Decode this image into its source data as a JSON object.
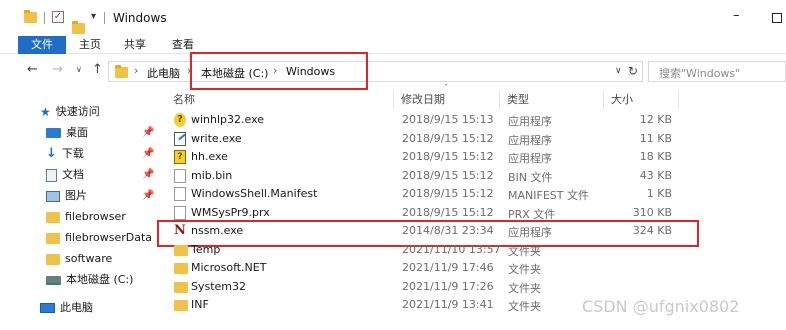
{
  "window": {
    "title": "Windows",
    "minimize": "–"
  },
  "ribbon": {
    "tabs": [
      "文件",
      "主页",
      "共享",
      "查看"
    ]
  },
  "nav": {
    "back": "←",
    "forward": "→",
    "dropdown": "∨",
    "up": "↑",
    "breadcrumb": [
      "此电脑",
      "本地磁盘 (C:)",
      "Windows"
    ],
    "separator": "›",
    "address_dropdown": "∨",
    "refresh": "↻",
    "search_placeholder": "搜索\"Windows\""
  },
  "sidebar": {
    "items": [
      {
        "label": "快速访问",
        "icon": "star-icon",
        "pinned": false
      },
      {
        "label": "桌面",
        "icon": "desktop-icon",
        "pinned": true
      },
      {
        "label": "下载",
        "icon": "download-icon",
        "pinned": true
      },
      {
        "label": "文档",
        "icon": "document-icon",
        "pinned": true
      },
      {
        "label": "图片",
        "icon": "pictures-icon",
        "pinned": true
      },
      {
        "label": "filebrowser",
        "icon": "folder-icon",
        "pinned": false
      },
      {
        "label": "filebrowserData",
        "icon": "folder-icon",
        "pinned": false
      },
      {
        "label": "software",
        "icon": "folder-icon",
        "pinned": false
      },
      {
        "label": "本地磁盘 (C:)",
        "icon": "drive-icon",
        "pinned": false
      },
      {
        "label": "此电脑",
        "icon": "computer-icon",
        "pinned": false
      }
    ],
    "pin_glyph": "📌"
  },
  "columns": {
    "name": "名称",
    "date": "修改日期",
    "type": "类型",
    "size": "大小"
  },
  "files": [
    {
      "name": "winhlp32.exe",
      "date": "2018/9/15 15:13",
      "type": "应用程序",
      "size": "12 KB",
      "icon": "help-icon"
    },
    {
      "name": "write.exe",
      "date": "2018/9/15 15:12",
      "type": "应用程序",
      "size": "11 KB",
      "icon": "write-icon"
    },
    {
      "name": "hh.exe",
      "date": "2018/9/15 15:12",
      "type": "应用程序",
      "size": "18 KB",
      "icon": "help-file-icon"
    },
    {
      "name": "mib.bin",
      "date": "2018/9/15 15:12",
      "type": "BIN 文件",
      "size": "43 KB",
      "icon": "file-icon"
    },
    {
      "name": "WindowsShell.Manifest",
      "date": "2018/9/15 15:12",
      "type": "MANIFEST 文件",
      "size": "1 KB",
      "icon": "file-icon"
    },
    {
      "name": "WMSysPr9.prx",
      "date": "2018/9/15 15:12",
      "type": "PRX 文件",
      "size": "310 KB",
      "icon": "file-icon"
    },
    {
      "name": "nssm.exe",
      "date": "2014/8/31 23:34",
      "type": "应用程序",
      "size": "324 KB",
      "icon": "nssm-icon"
    },
    {
      "name": "Temp",
      "date": "2021/11/10 13:57",
      "type": "文件夹",
      "size": "",
      "icon": "folder-icon"
    },
    {
      "name": "Microsoft.NET",
      "date": "2021/11/9 17:46",
      "type": "文件夹",
      "size": "",
      "icon": "folder-icon"
    },
    {
      "name": "System32",
      "date": "2021/11/9 17:26",
      "type": "文件夹",
      "size": "",
      "icon": "folder-icon"
    },
    {
      "name": "INF",
      "date": "2021/11/9 13:41",
      "type": "文件夹",
      "size": "",
      "icon": "folder-icon"
    }
  ],
  "watermark": "CSDN @ufgnix0802",
  "colors": {
    "accent": "#1e6ec8",
    "highlight_box": "#d9272d",
    "folder": "#f1c24a"
  }
}
